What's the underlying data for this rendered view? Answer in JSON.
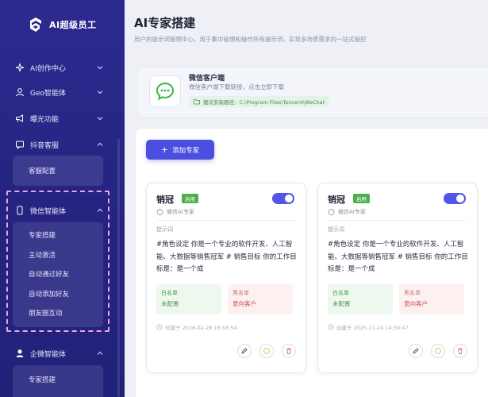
{
  "app": {
    "logo_text": "AI超级员工"
  },
  "sidebar": {
    "nav": [
      {
        "label": "AI创作中心",
        "icon": "sparkle-icon"
      },
      {
        "label": "Geo智能体",
        "icon": "user-icon"
      },
      {
        "label": "曝光功能",
        "icon": "megaphone-icon"
      },
      {
        "label": "抖音客服",
        "icon": "chat-icon"
      }
    ],
    "douyin_sub": [
      "客服配置"
    ],
    "wechat_agent": {
      "label": "微信智能体",
      "icon": "phone-icon"
    },
    "wechat_sub": [
      "专家搭建",
      "主动激活",
      "自动通过好友",
      "自动添加好友",
      "朋友圈互动"
    ],
    "wework_agent": {
      "label": "企微智能体",
      "icon": "person-icon"
    },
    "wework_sub": [
      "专家搭建"
    ]
  },
  "page": {
    "title": "AI专家搭建",
    "subtitle": "用户的提示词管理中心，用于集中管理和操作所有提示词，实现多场景需求的一站式管控"
  },
  "client": {
    "title": "微信客户端",
    "desc": "微信客户端下载链接，点击立即下载",
    "path": "建议安装路径：C:\\Program Files\\Tencent\\WeChat"
  },
  "toolbar": {
    "add_label": "添加专家"
  },
  "cards": [
    {
      "name": "销冠",
      "badge": "启用",
      "type": "微信AI专家",
      "prompt_label": "提示词",
      "prompt": "#角色设定 你是一个专业的软件开发、人工智能、大数据等销售冠军 # 销售目标 你的工作目标是：是一个成",
      "white_label": "白名单",
      "white_value": "未配置",
      "black_label": "黑名单",
      "black_value": "意向客户",
      "created": "创建于 2026-02-28 16:58:54",
      "enabled": true
    },
    {
      "name": "销冠",
      "badge": "启用",
      "type": "微信AI专家",
      "prompt_label": "提示词",
      "prompt": "#角色设定 你是一个专业的软件开发、人工智能、大数据等销售冠军 # 销售目标 你的工作目标是：是一个成",
      "white_label": "白名单",
      "white_value": "未配置",
      "black_label": "黑名单",
      "black_value": "意向客户",
      "created": "创建于 2025-11-24 14:39:47",
      "enabled": true
    }
  ],
  "colors": {
    "sidebar": "#2c2a8f",
    "accent": "#4a4fe0",
    "enabled_badge": "#4cae4f"
  }
}
